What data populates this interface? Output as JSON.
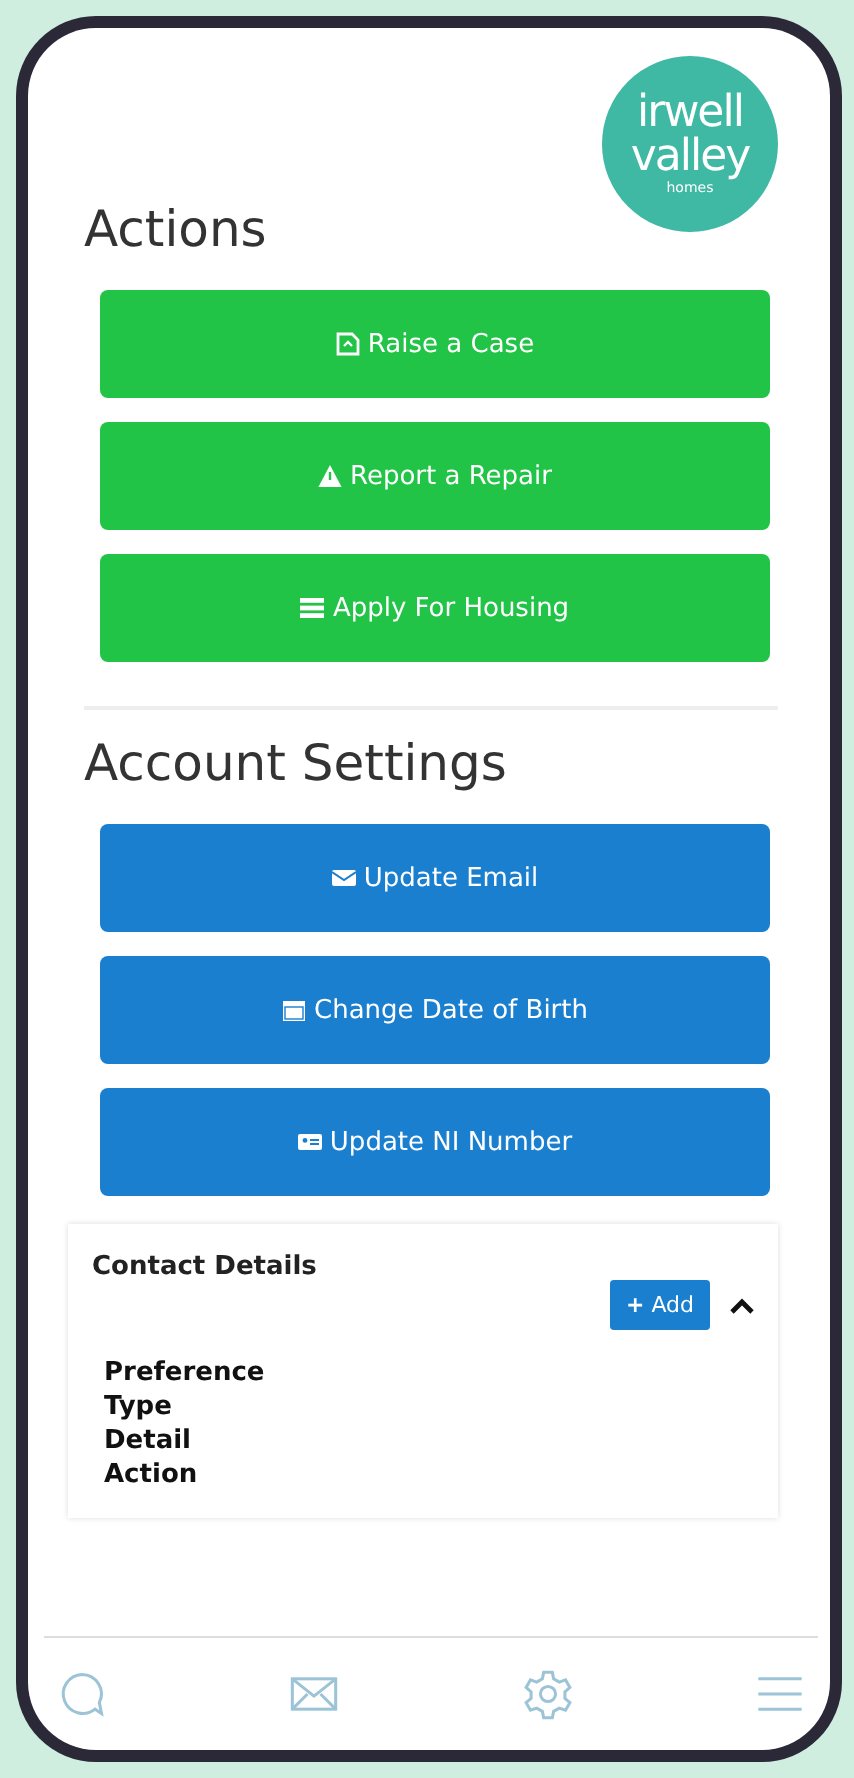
{
  "logo": {
    "lines": [
      "irwell",
      "valley",
      "homes"
    ]
  },
  "sections": [
    {
      "title": "Actions",
      "kind": "green",
      "buttons": [
        {
          "label": "Raise a Case",
          "kind": "case"
        },
        {
          "label": "Report a Repair",
          "kind": "warning"
        },
        {
          "label": "Apply For Housing",
          "kind": "list"
        }
      ]
    },
    {
      "title": "Account Settings",
      "kind": "blue",
      "buttons": [
        {
          "label": "Update Email",
          "kind": "envelope"
        },
        {
          "label": "Change Date of Birth",
          "kind": "calendar"
        },
        {
          "label": "Update NI Number",
          "kind": "card"
        }
      ]
    }
  ],
  "contact_details": {
    "title": "Contact Details",
    "add_button": {
      "icon": "+",
      "label": "Add"
    },
    "expanded": true,
    "columns": [
      "Preference",
      "Type",
      "Detail",
      "Action"
    ]
  },
  "bottom_nav": [
    {
      "kind": "chat"
    },
    {
      "kind": "envelope"
    },
    {
      "kind": "gear"
    },
    {
      "kind": "menu"
    }
  ]
}
